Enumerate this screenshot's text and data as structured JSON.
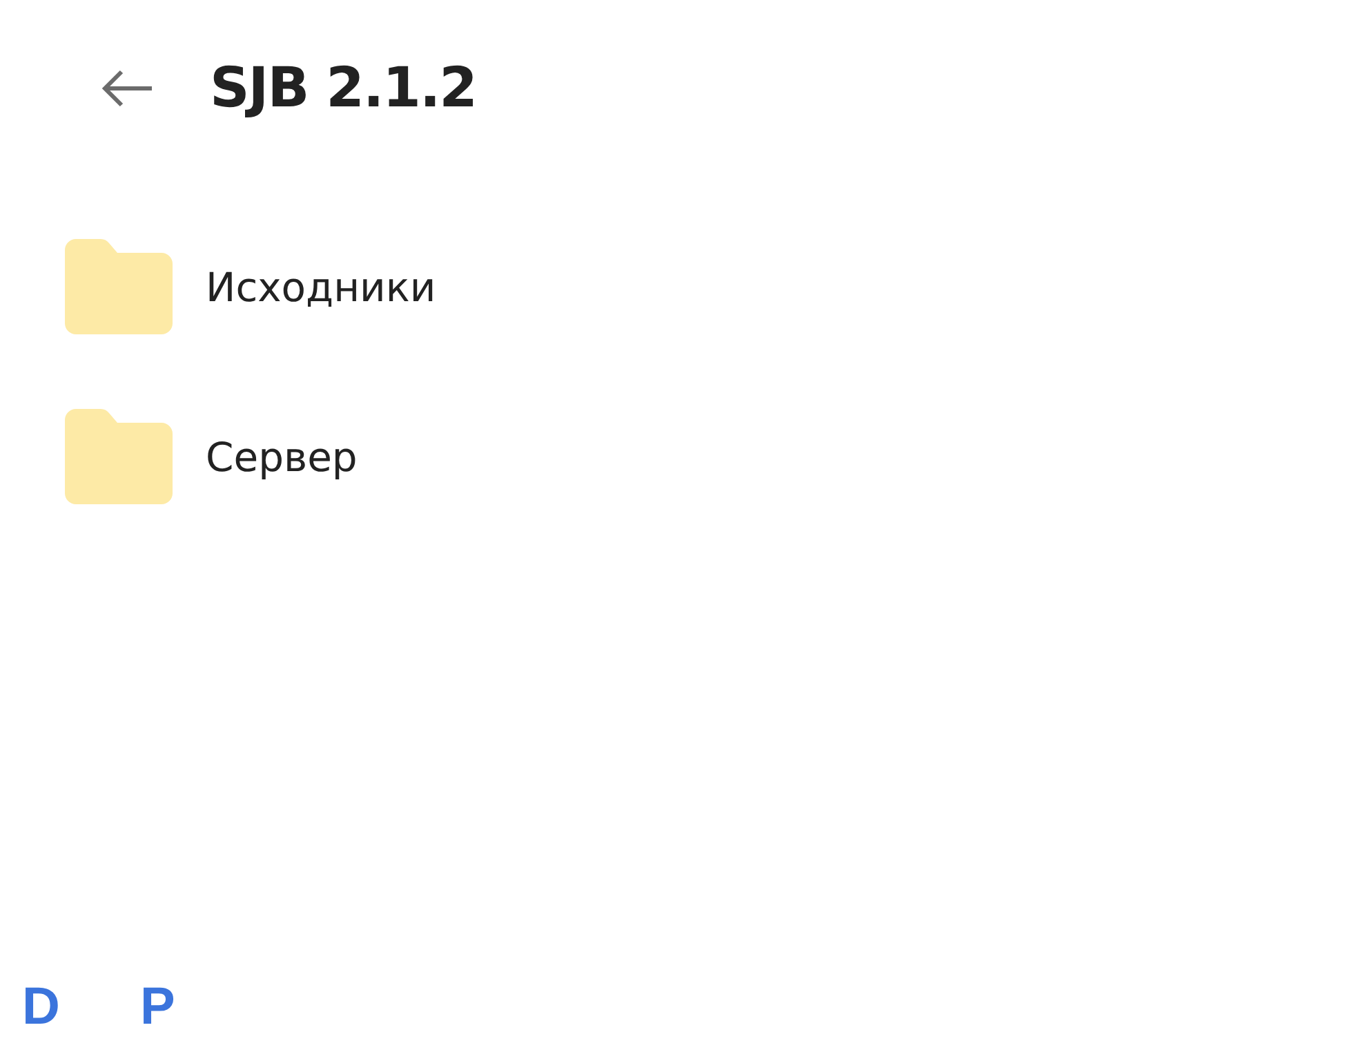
{
  "header": {
    "title": "SJB 2.1.2"
  },
  "items": [
    {
      "name": "Исходники",
      "kind": "folder"
    },
    {
      "name": "Сервер",
      "kind": "folder"
    }
  ],
  "footer": {
    "letters": [
      "D",
      "P"
    ]
  }
}
